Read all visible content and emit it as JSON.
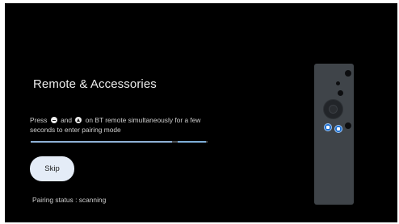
{
  "screen": {
    "title": "Remote & Accessories",
    "instructions": {
      "part1": "Press",
      "part2": "and",
      "part3": "on BT remote simultaneously for a few seconds to enter pairing mode",
      "inline_icons": [
        "back-button-icon",
        "home-button-icon"
      ]
    },
    "progress": {
      "segments": [
        {
          "start": 0.0,
          "end": 0.8,
          "color": "#8fb1d6"
        },
        {
          "start": 0.83,
          "end": 0.99,
          "color": "#7eaed8"
        }
      ]
    },
    "skip_label": "Skip",
    "pairing_status": "Pairing status : scanning"
  },
  "remote_illustration": {
    "highlighted_buttons": [
      "back-button-icon",
      "home-button-icon"
    ],
    "highlight_color": "#1e6fd0"
  },
  "colors": {
    "background": "#000000",
    "accent": "#8fb1d6",
    "button_bg": "#e4ecf7"
  }
}
